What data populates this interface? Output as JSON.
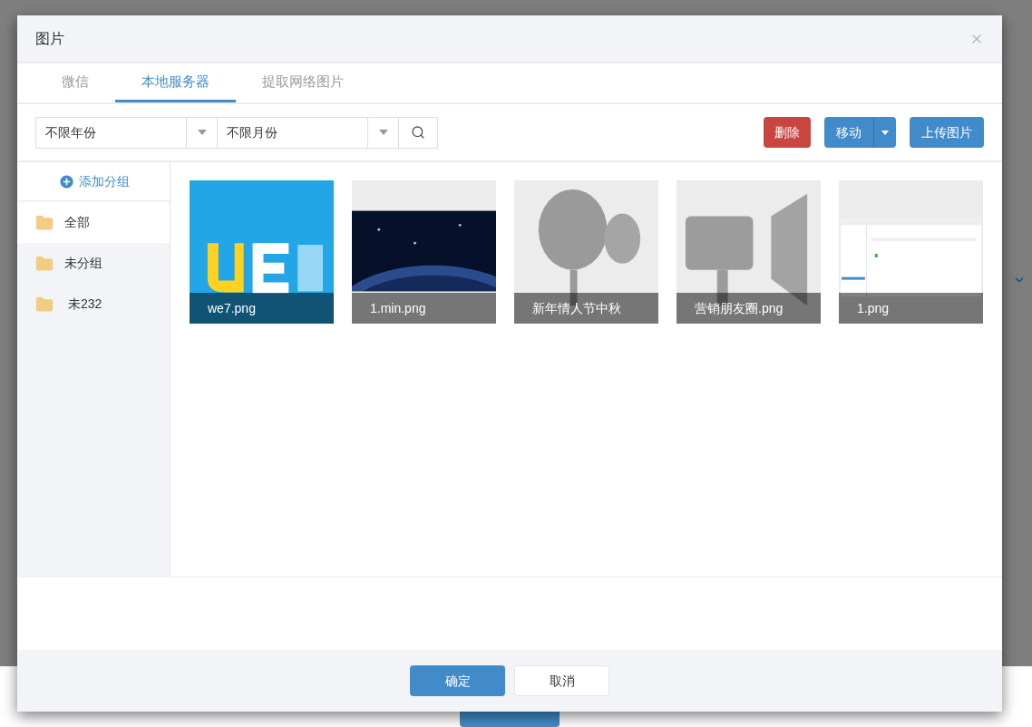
{
  "dialog": {
    "title": "图片",
    "tabs": [
      {
        "label": "微信",
        "selected": false
      },
      {
        "label": "本地服务器",
        "selected": true
      },
      {
        "label": "提取网络图片",
        "selected": false
      }
    ],
    "filters": [
      {
        "value": "不限年份"
      },
      {
        "value": "不限月份"
      }
    ],
    "actions": {
      "delete": "删除",
      "move": "移动",
      "upload": "上传图片"
    },
    "add_group": "添加分组",
    "groups": [
      {
        "label": "全部",
        "selected": true
      },
      {
        "label": "未分组",
        "selected": false
      },
      {
        "label": " 未232",
        "selected": false
      }
    ],
    "images": [
      {
        "kind": "logo",
        "name": "we7.png"
      },
      {
        "kind": "space",
        "name": "1.min.png"
      },
      {
        "kind": "balloon",
        "name": "新年情人节中秋"
      },
      {
        "kind": "speaker",
        "name": "营销朋友圈.png"
      },
      {
        "kind": "screen",
        "name": "1.png"
      }
    ],
    "buttons": {
      "ok": "确定",
      "cancel": "取消"
    }
  }
}
